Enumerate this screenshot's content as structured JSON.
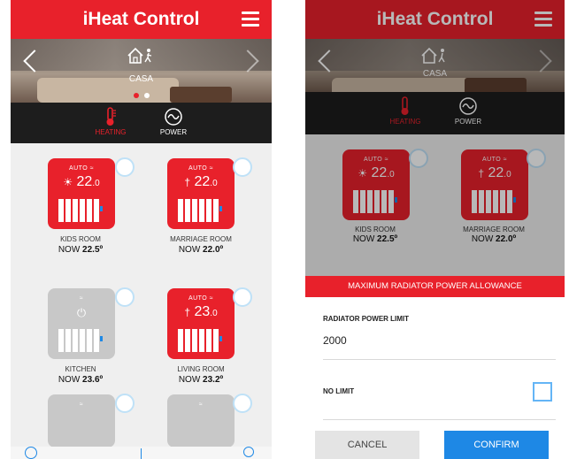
{
  "app": {
    "title": "iHeat Control"
  },
  "location": {
    "name": "CASA"
  },
  "tabs": {
    "heating": "HEATING",
    "power": "POWER"
  },
  "rooms": [
    {
      "mode": "AUTO",
      "setpoint": "22",
      "decimal": ".0",
      "name": "KIDS ROOM",
      "now_prefix": "NOW",
      "now_value": "22.5º",
      "state": "heating"
    },
    {
      "mode": "AUTO",
      "setpoint": "22",
      "decimal": ".0",
      "name": "MARRIAGE ROOM",
      "now_prefix": "NOW",
      "now_value": "22.0º",
      "state": "heating"
    },
    {
      "mode": "",
      "setpoint": "",
      "decimal": "",
      "name": "KITCHEN",
      "now_prefix": "NOW",
      "now_value": "23.6º",
      "state": "off"
    },
    {
      "mode": "AUTO",
      "setpoint": "23",
      "decimal": ".0",
      "name": "LIVING ROOM",
      "now_prefix": "NOW",
      "now_value": "23.2º",
      "state": "heating"
    }
  ],
  "dialog": {
    "title": "MAXIMUM RADIATOR POWER ALLOWANCE",
    "limit_label": "RADIATOR POWER LIMIT",
    "limit_value": "2000",
    "no_limit_label": "NO LIMIT",
    "no_limit_checked": false,
    "cancel": "CANCEL",
    "confirm": "CONFIRM"
  },
  "colors": {
    "brand_red": "#e8212b",
    "confirm_blue": "#1e88e5",
    "tab_bar": "#1d1d1d"
  },
  "icons": [
    "menu-icon",
    "home-person-icon",
    "chevron-left-icon",
    "chevron-right-icon",
    "thermometer-icon",
    "power-wave-icon",
    "wifi-icon",
    "sun-icon",
    "radiator-icon",
    "power-off-icon"
  ]
}
